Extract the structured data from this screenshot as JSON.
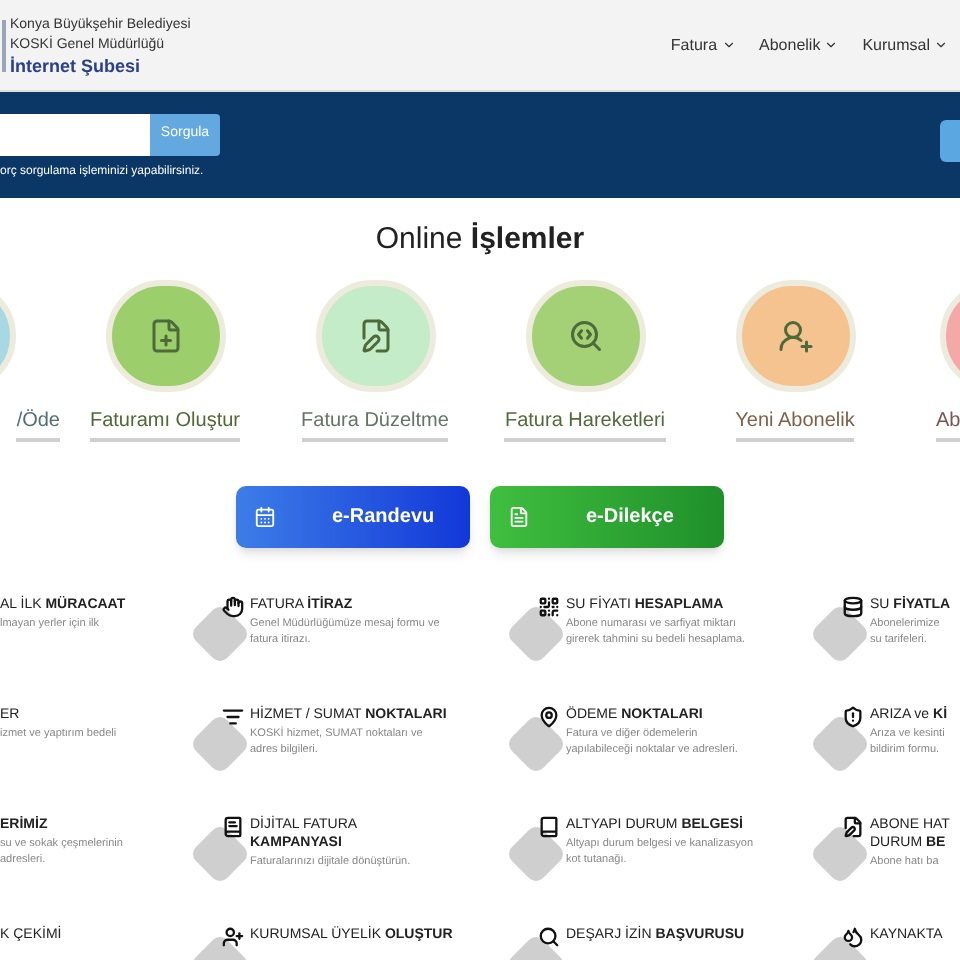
{
  "header": {
    "org_lines": [
      "Konya Büyükşehir Belediyesi",
      "KOSKİ Genel Müdürlüğü"
    ],
    "portal": "İnternet Şubesi",
    "nav": [
      "Fatura",
      "Abonelik",
      "Kurumsal"
    ]
  },
  "query": {
    "button": "Sorgula",
    "hint": "orç sorgulama işleminizi yapabilirsiniz."
  },
  "section_title": "Online **İşlemler**",
  "operations": [
    {
      "label": "/Öde",
      "color": "#a8d8e4"
    },
    {
      "label": "Faturamı Oluştur",
      "color": "#9ccf6c"
    },
    {
      "label": "Fatura Düzeltme",
      "color": "#c5ecc9"
    },
    {
      "label": "Fatura Hareketleri",
      "color": "#a4d176"
    },
    {
      "label": "Yeni Abonelik",
      "color": "#f5c390"
    },
    {
      "label": "Ab",
      "color": "#f4a8a8"
    }
  ],
  "quick_buttons": [
    {
      "label": "e-Randevu",
      "kind": "calendar"
    },
    {
      "label": "e-Dilekçe",
      "kind": "document"
    }
  ],
  "services": [
    {
      "title": "AL İLK **MÜRACAAT**",
      "desc": "lmayan yerler için ilk"
    },
    {
      "title": "FATURA **İTİRAZ**",
      "desc": "Genel Müdürlüğümüze mesaj formu ve\nfatura itirazı."
    },
    {
      "title": "SU FİYATI **HESAPLAMA**",
      "desc": "Abone numarası ve sarfiyat miktarı\ngirerek tahmini su bedeli hesaplama."
    },
    {
      "title": "SU **FİYATLA**",
      "desc": "Abonelerimize\nsu tarifeleri."
    },
    {
      "title": "ER",
      "desc": "izmet ve yaptırım bedeli"
    },
    {
      "title": "HİZMET / SUMAT **NOKTALARI**",
      "desc": "KOSKİ hizmet, SUMAT noktaları ve\nadres bilgileri."
    },
    {
      "title": "ÖDEME **NOKTALARI**",
      "desc": "Fatura ve diğer ödemelerin\nyapılabileceği noktalar ve adresleri."
    },
    {
      "title": "ARIZA ve **Kİ**",
      "desc": "Arıza ve kesinti\nbildirim formu."
    },
    {
      "title": "**ERİMİZ**",
      "desc": "su ve sokak çeşmelerinin\nadresleri."
    },
    {
      "title": "DİJİTAL FATURA\n**KAMPANYASI**",
      "desc": "Faturalarınızı dijitale dönüştürün."
    },
    {
      "title": "ALTYAPI DURUM **BELGESİ**",
      "desc": "Altyapı durum belgesi ve kanalizasyon\nkot tutanağı."
    },
    {
      "title": "ABONE HAT\nDURUM **BE**",
      "desc": "Abone hatı ba"
    },
    {
      "title": "K ÇEKİMİ"
    },
    {
      "title": "KURUMSAL ÜYELİK **OLUŞTUR**"
    },
    {
      "title": "DEŞARJ İZİN **BAŞVURUSU**"
    },
    {
      "title": "KAYNAKTA"
    }
  ]
}
